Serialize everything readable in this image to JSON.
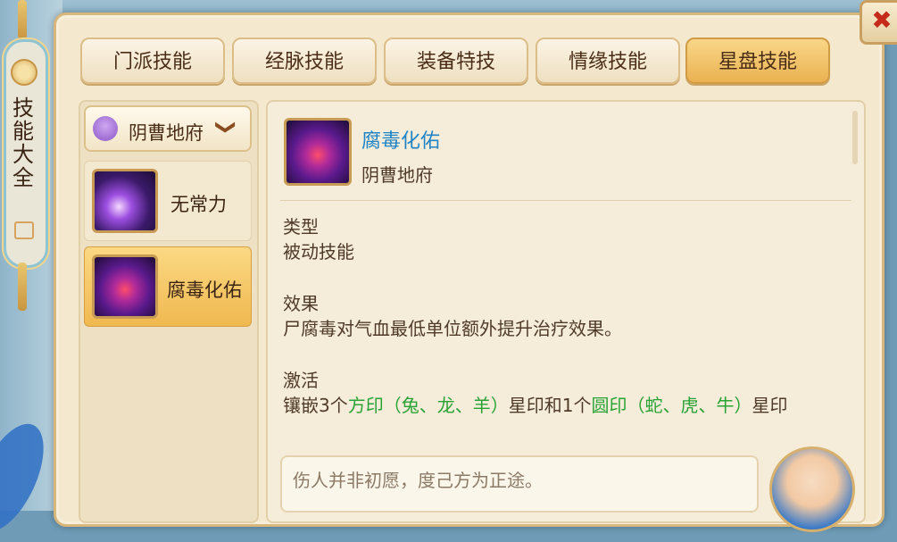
{
  "window": {
    "side_title": "技能大全",
    "close_glyph": "✖"
  },
  "tabs": [
    {
      "label": "门派技能",
      "active": false
    },
    {
      "label": "经脉技能",
      "active": false
    },
    {
      "label": "装备特技",
      "active": false
    },
    {
      "label": "情缘技能",
      "active": false
    },
    {
      "label": "星盘技能",
      "active": true
    }
  ],
  "school_dropdown": {
    "selected": "阴曹地府",
    "icon": "skull-icon",
    "chevron": "❯"
  },
  "skill_list": [
    {
      "label": "无常力",
      "icon": "wuchang-skill-icon",
      "selected": false
    },
    {
      "label": "腐毒化佑",
      "icon": "fudu-skill-icon",
      "selected": true
    }
  ],
  "detail": {
    "name": "腐毒化佑",
    "school": "阴曹地府",
    "type_title": "类型",
    "type_value": "被动技能",
    "effect_title": "效果",
    "effect_value": "尸腐毒对气血最低单位额外提升治疗效果。",
    "activate_title": "激活",
    "activate_parts": {
      "p1": "镶嵌3个",
      "p2": "方印（兔、龙、羊）",
      "p3": "星印和1个",
      "p4": "圆印（蛇、虎、牛）",
      "p5": "星印"
    }
  },
  "quote": "伤人并非初愿，度己方为正途。",
  "colors": {
    "accent_blue": "#1f84c8",
    "green_text": "#2aa335",
    "active_tab": "#f0b850",
    "close_red": "#c52a1b"
  }
}
